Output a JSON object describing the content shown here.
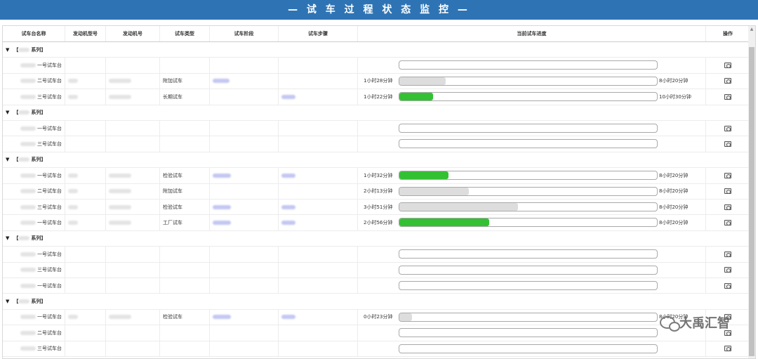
{
  "title": "— 试 车 过 程 状 态 监 控 —",
  "columns": [
    "试车台名称",
    "发动机型号",
    "发动机号",
    "试车类型",
    "试车阶段",
    "试车步骤",
    "当前试车进度",
    "操作"
  ],
  "colors": {
    "title_bg": "#2e74b5",
    "progress_green": "#33c133",
    "progress_gray": "#dddddd"
  },
  "rows": [
    {
      "kind": "group",
      "label": "系列",
      "prefix": "【",
      "suffix": "】"
    },
    {
      "kind": "stand",
      "name": "一号试车台",
      "type": "",
      "elapsed": "",
      "total": "",
      "progress": 0,
      "fill": "none"
    },
    {
      "kind": "stand",
      "name": "二号试车台",
      "type": "附加试车",
      "elapsed": "1小时28分钟",
      "total": "8小时20分钟",
      "progress": 0.18,
      "fill": "gray"
    },
    {
      "kind": "stand",
      "name": "三号试车台",
      "type": "长期试车",
      "elapsed": "1小时22分钟",
      "total": "10小时30分钟",
      "progress": 0.13,
      "fill": "green"
    },
    {
      "kind": "group",
      "label": "系列",
      "prefix": "【",
      "suffix": "】"
    },
    {
      "kind": "stand",
      "name": "一号试车台",
      "type": "",
      "elapsed": "",
      "total": "",
      "progress": 0,
      "fill": "none"
    },
    {
      "kind": "stand",
      "name": "三号试车台",
      "type": "",
      "elapsed": "",
      "total": "",
      "progress": 0,
      "fill": "none"
    },
    {
      "kind": "group",
      "label": "系列",
      "prefix": "【",
      "suffix": "】"
    },
    {
      "kind": "stand",
      "name": "一号试车台",
      "type": "检验试车",
      "elapsed": "1小时32分钟",
      "total": "8小时20分钟",
      "progress": 0.19,
      "fill": "green"
    },
    {
      "kind": "stand",
      "name": "二号试车台",
      "type": "附加试车",
      "elapsed": "2小时13分钟",
      "total": "8小时20分钟",
      "progress": 0.27,
      "fill": "gray"
    },
    {
      "kind": "stand",
      "name": "三号试车台",
      "type": "检验试车",
      "elapsed": "3小时51分钟",
      "total": "8小时20分钟",
      "progress": 0.46,
      "fill": "gray"
    },
    {
      "kind": "stand",
      "name": "一号试车台",
      "type": "工厂试车",
      "elapsed": "2小时56分钟",
      "total": "8小时20分钟",
      "progress": 0.35,
      "fill": "green"
    },
    {
      "kind": "group",
      "label": "系列",
      "prefix": "【",
      "suffix": "】"
    },
    {
      "kind": "stand",
      "name": "一号试车台",
      "type": "",
      "elapsed": "",
      "total": "",
      "progress": 0,
      "fill": "none"
    },
    {
      "kind": "stand",
      "name": "三号试车台",
      "type": "",
      "elapsed": "",
      "total": "",
      "progress": 0,
      "fill": "none"
    },
    {
      "kind": "stand",
      "name": "一号试车台",
      "type": "",
      "elapsed": "",
      "total": "",
      "progress": 0,
      "fill": "none"
    },
    {
      "kind": "group",
      "label": "系列",
      "prefix": "【",
      "suffix": "】"
    },
    {
      "kind": "stand",
      "name": "一号试车台",
      "type": "检验试车",
      "elapsed": "0小时23分钟",
      "total": "8小时20分钟",
      "progress": 0.05,
      "fill": "gray"
    },
    {
      "kind": "stand",
      "name": "二号试车台",
      "type": "",
      "elapsed": "",
      "total": "",
      "progress": 0,
      "fill": "none"
    },
    {
      "kind": "stand",
      "name": "三号试车台",
      "type": "",
      "elapsed": "",
      "total": "",
      "progress": 0,
      "fill": "none"
    }
  ],
  "watermark": "大禹汇智",
  "icons": {
    "action": "camera-icon",
    "group_toggle": "caret-down-icon",
    "watermark": "wechat-icon"
  }
}
